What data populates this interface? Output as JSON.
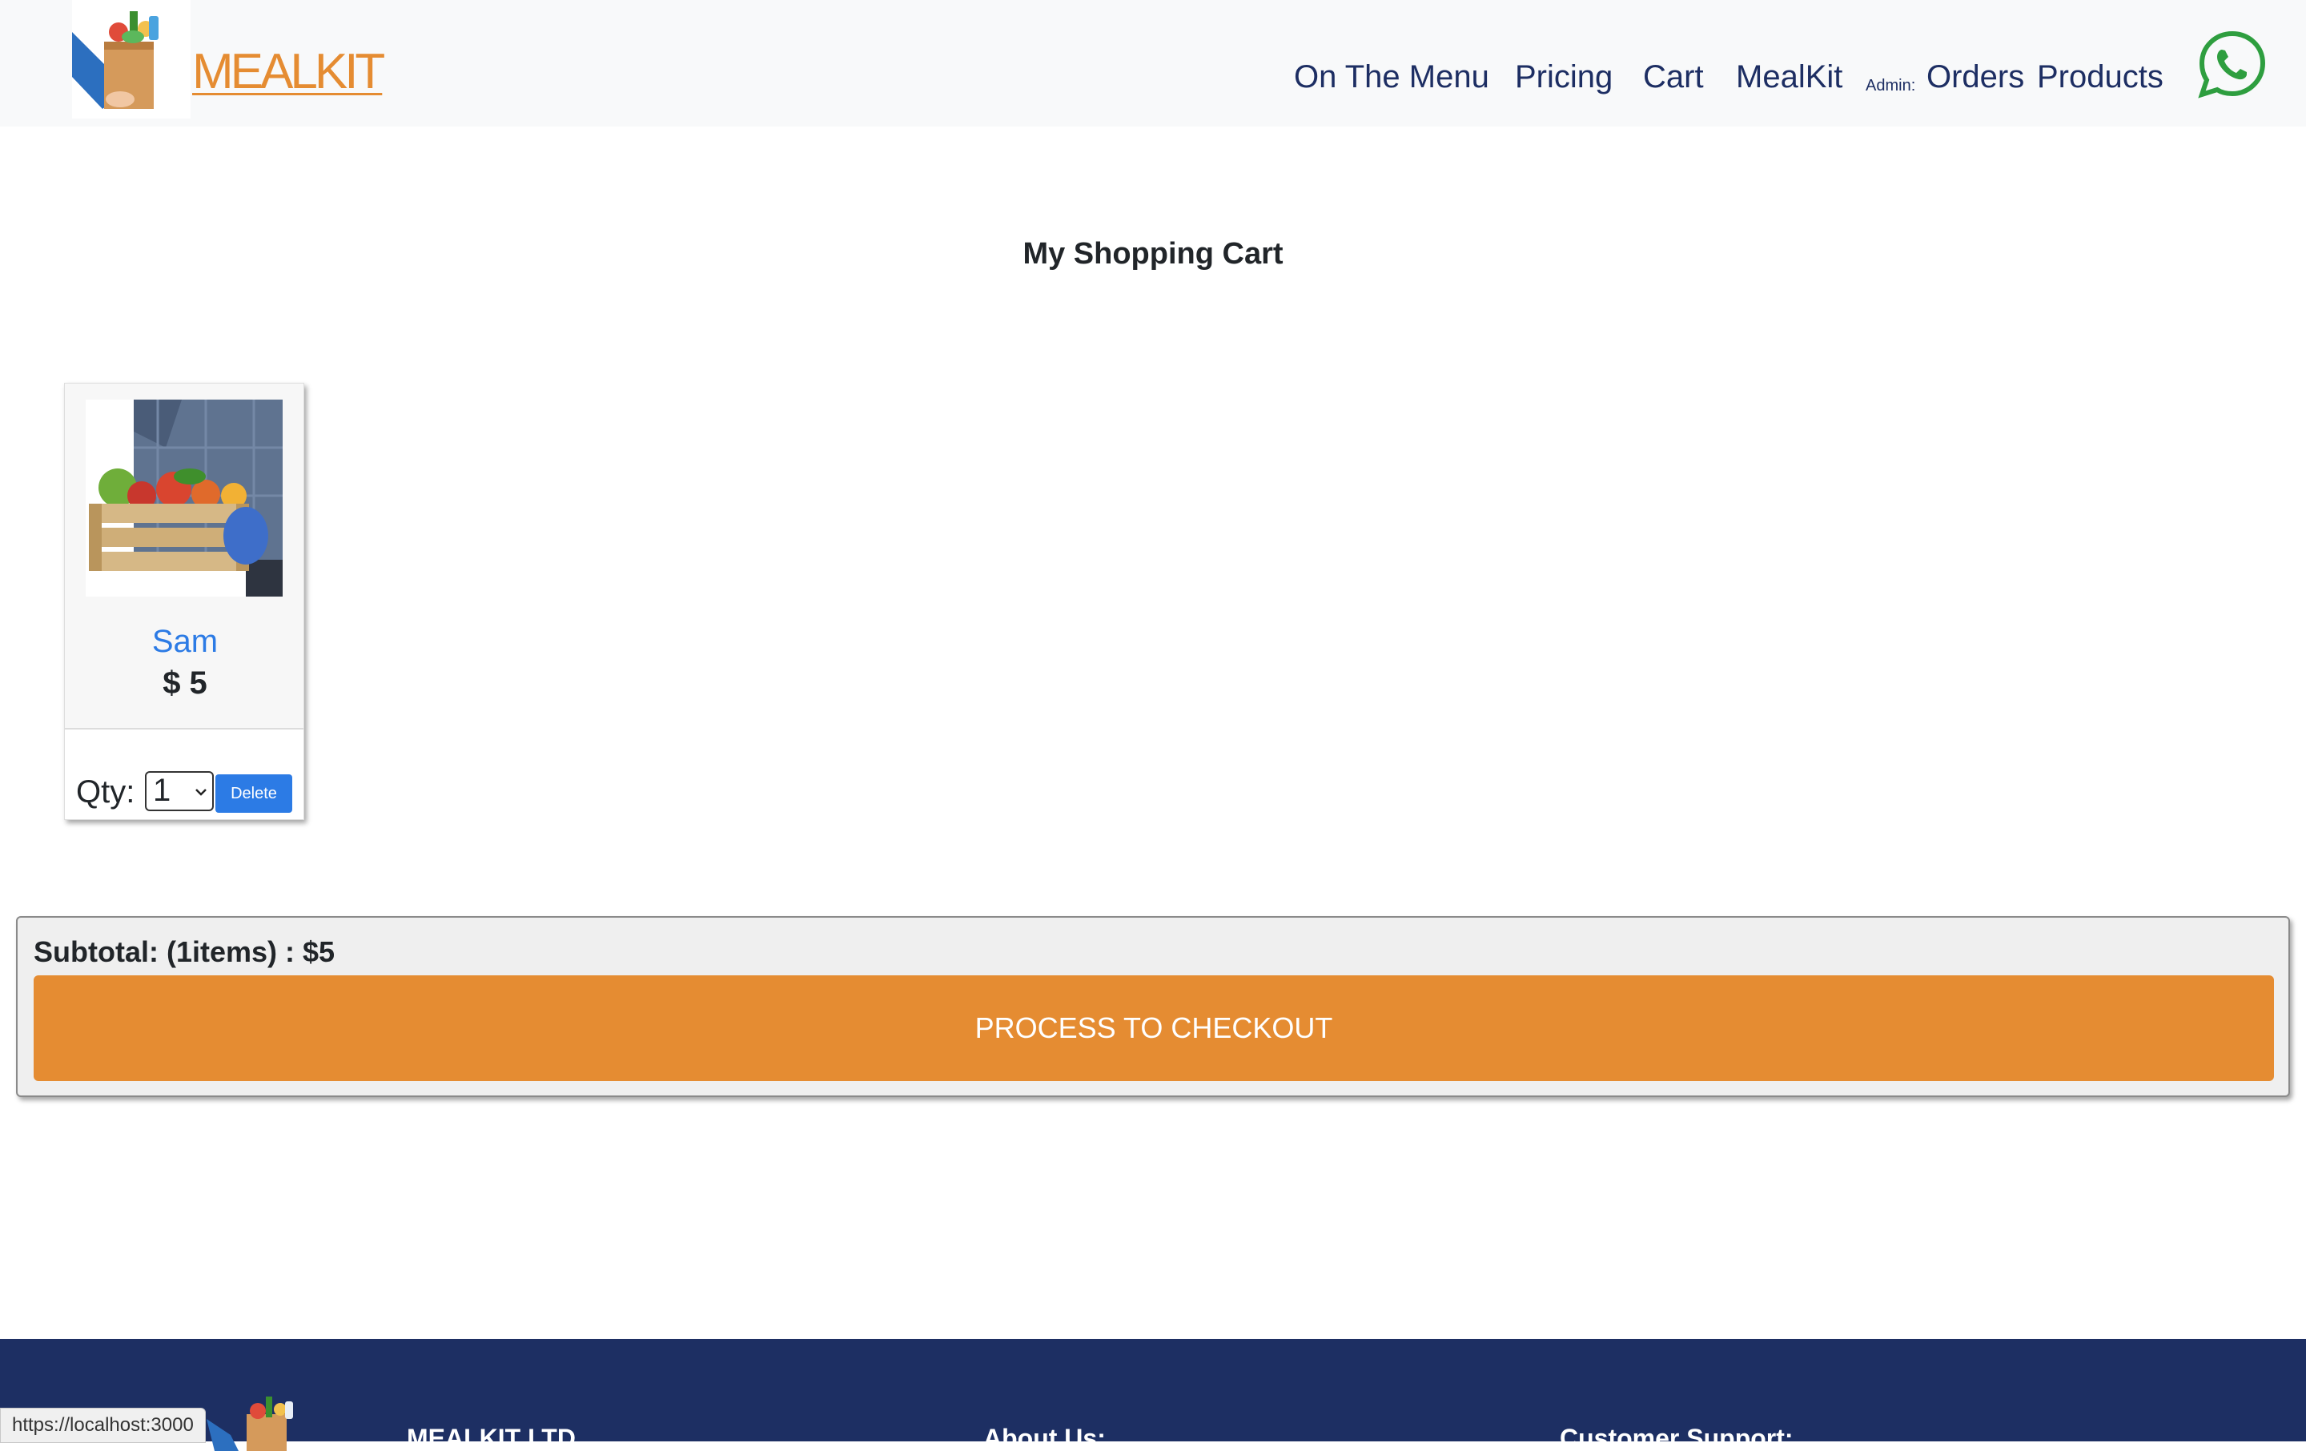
{
  "header": {
    "brand": "MEALKIT",
    "nav": {
      "on_the_menu": "On The Menu",
      "pricing": "Pricing",
      "cart": "Cart",
      "mealkit": "MealKit",
      "admin_label": "Admin:",
      "orders": "Orders",
      "products": "Products"
    },
    "icons": {
      "logo": "grocery-bag-logo",
      "whatsapp": "whatsapp-icon"
    }
  },
  "page_title": "My Shopping Cart",
  "cart_items": [
    {
      "name": "Sam",
      "price": "$ 5",
      "qty_label": "Qty:",
      "qty_value": "1",
      "delete_label": "Delete",
      "image": "vegetable-crate"
    }
  ],
  "summary": {
    "subtotal": "Subtotal: (1items) : $5",
    "checkout_label": "PROCESS TO CHECKOUT"
  },
  "footer": {
    "company": "MEALKIT LTD",
    "about": "About Us:",
    "support": "Customer Support:"
  },
  "status_bar": {
    "url": "https://localhost:3000"
  },
  "colors": {
    "brand_orange": "#e58c32",
    "nav_navy": "#1d2e63",
    "link_blue": "#2c7be5",
    "footer_navy": "#1d2f63",
    "whatsapp_green": "#2e9e3f"
  }
}
